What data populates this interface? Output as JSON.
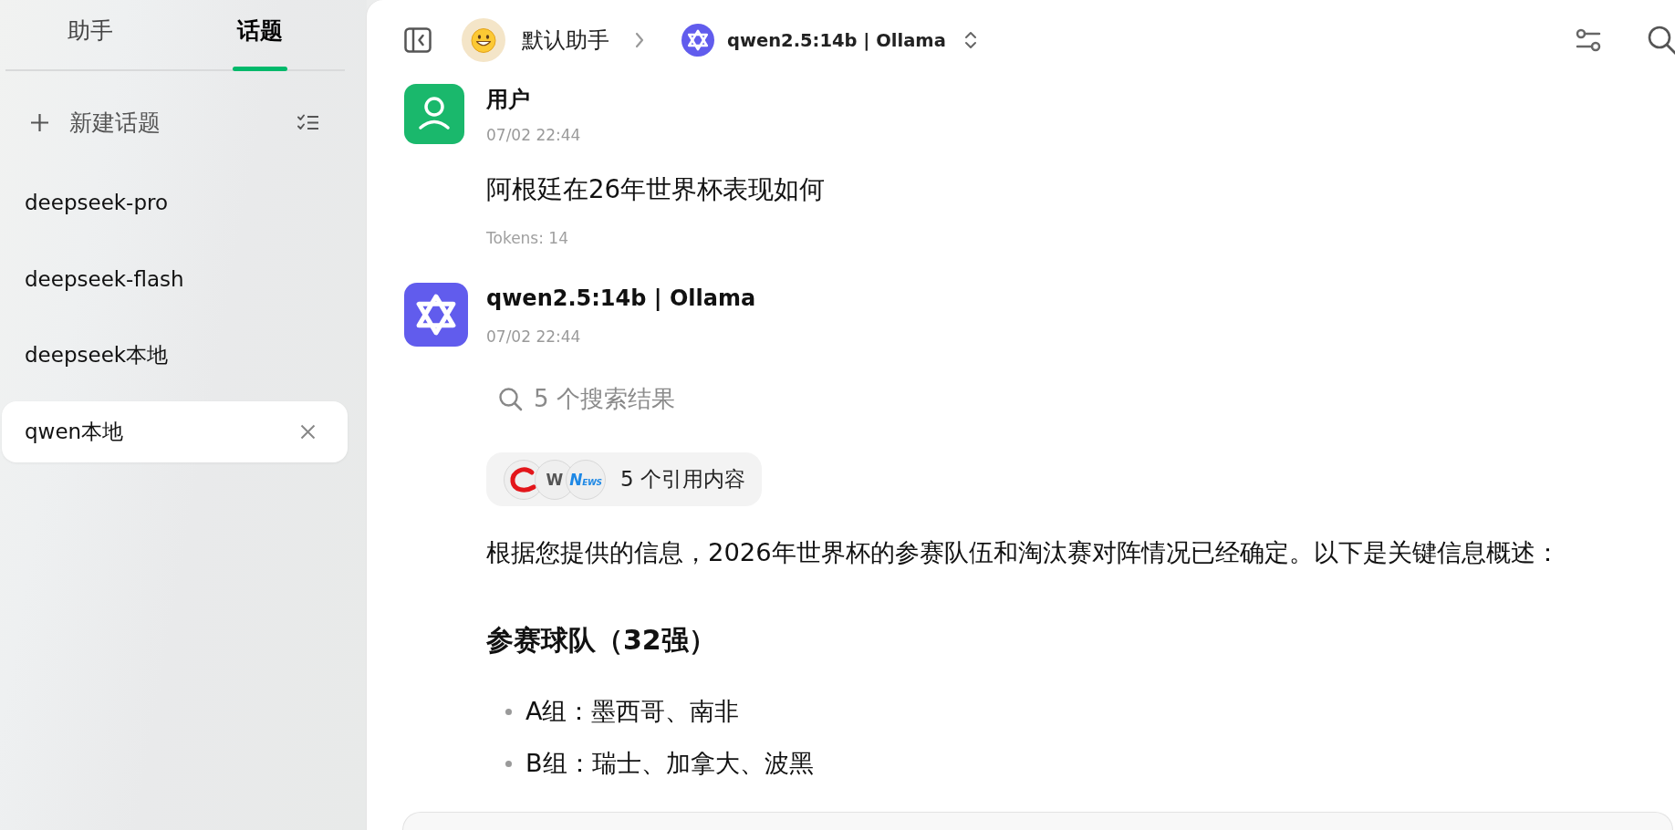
{
  "sidebar": {
    "tabs": [
      {
        "label": "助手",
        "selected": false
      },
      {
        "label": "话题",
        "selected": true
      }
    ],
    "new_topic": "新建话题",
    "topics": [
      {
        "title": "deepseek-pro",
        "selected": false
      },
      {
        "title": "deepseek-flash",
        "selected": false
      },
      {
        "title": "deepseek本地",
        "selected": false
      },
      {
        "title": "qwen本地",
        "selected": true
      }
    ]
  },
  "header": {
    "assistant": "默认助手",
    "model": "qwen2.5:14b | Ollama"
  },
  "messages": [
    {
      "kind": "user",
      "sender": "用户",
      "time": "07/02 22:44",
      "text": "阿根廷在26年世界杯表现如何",
      "tokens": "Tokens: 14"
    },
    {
      "kind": "assistant",
      "sender": "qwen2.5:14b | Ollama",
      "time": "07/02 22:44",
      "search_results": "5 个搜索结果",
      "citations": {
        "label": "5 个引用内容",
        "sources": [
          {
            "kind": "swirl"
          },
          {
            "kind": "letter",
            "label": "W"
          },
          {
            "kind": "wordmark",
            "label": "NEWS"
          }
        ]
      },
      "blocks": [
        {
          "kind": "paragraph",
          "text": "根据您提供的信息，2026年世界杯的参赛队伍和淘汰赛对阵情况已经确定。以下是关键信息概述："
        },
        {
          "kind": "heading",
          "text": "参赛球队（32强）"
        },
        {
          "kind": "list",
          "items": [
            "A组：墨西哥、南非",
            "B组：瑞士、加拿大、波黑"
          ]
        }
      ]
    }
  ]
}
